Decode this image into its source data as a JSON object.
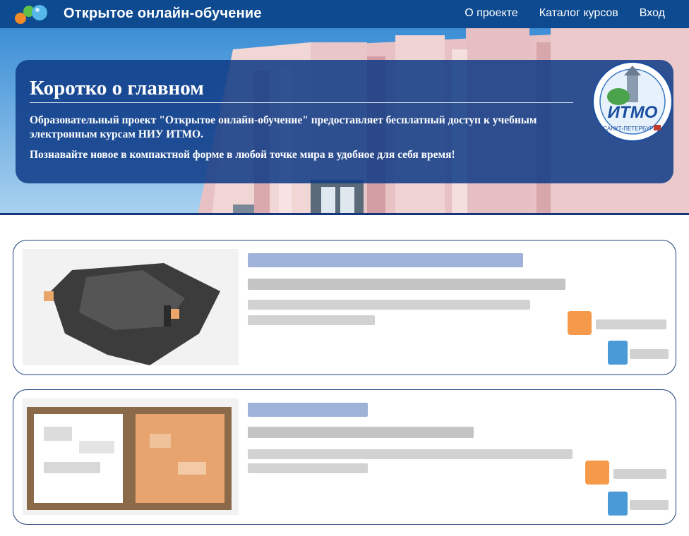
{
  "header": {
    "site_title": "Открытое онлайн-обучение",
    "nav": [
      "О проекте",
      "Каталог курсов",
      "Вход"
    ]
  },
  "hero": {
    "title": "Коротко о главном",
    "paragraph1": "Образовательный проект \"Открытое онлайн-обучение\" предоставляет бесплатный доступ к учебным электронным курсам НИУ ИТМО.",
    "paragraph2": "Познавайте новое в компактной форме в любой точке мира в удобное для себя время!",
    "emblem_text": "ИТМО",
    "emblem_subtext": "САНКТ-ПЕТЕРБУРГ"
  },
  "colors": {
    "header_bg": "#0d4a8f",
    "info_box": "#0e3a86",
    "card_border": "#1d3f7a",
    "accent_orange": "#f59a4a",
    "accent_blue": "#4a9ad8"
  }
}
